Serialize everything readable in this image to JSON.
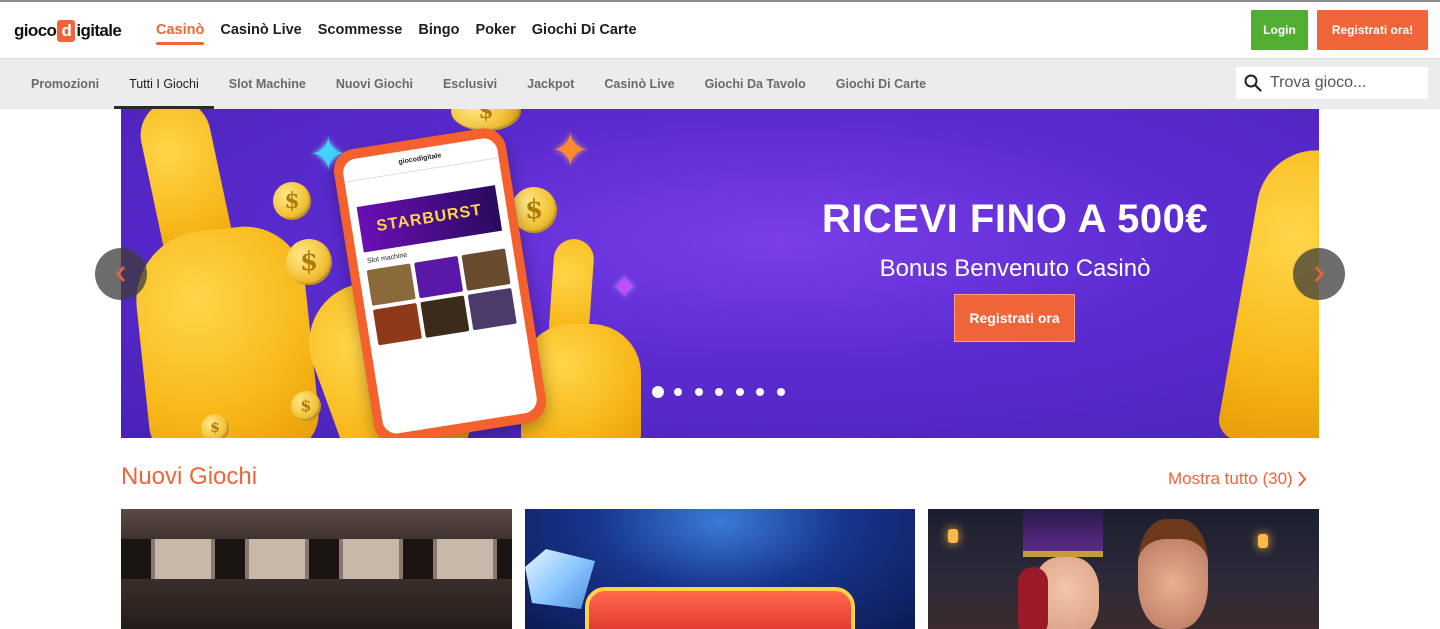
{
  "brand": {
    "logo_part1": "gioco",
    "logo_letter": "d",
    "logo_part2": "igitale",
    "accent_color": "#f0643a",
    "login_color": "#52ae32"
  },
  "header": {
    "nav": [
      "Casinò",
      "Casinò Live",
      "Scommesse",
      "Bingo",
      "Poker",
      "Giochi Di Carte"
    ],
    "active_nav": "Casinò",
    "login_label": "Login",
    "register_label": "Registrati ora!"
  },
  "subnav": {
    "tabs": [
      "Promozioni",
      "Tutti I Giochi",
      "Slot Machine",
      "Nuovi Giochi",
      "Esclusivi",
      "Jackpot",
      "Casinò Live",
      "Giochi Da Tavolo",
      "Giochi Di Carte"
    ],
    "active_tab": "Tutti I Giochi",
    "search_placeholder": "Trova gioco..."
  },
  "hero": {
    "title": "RICEVI FINO A 500€",
    "subtitle": "Bonus Benvenuto Casinò",
    "cta_label": "Registrati ora",
    "phone_logo": "giocodigitale",
    "phone_game": "STARBURST",
    "phone_section": "Slot machine",
    "slide_count": 7,
    "active_slide": 1
  },
  "section": {
    "title": "Nuovi Giochi",
    "show_all": "Mostra tutto (30)"
  }
}
